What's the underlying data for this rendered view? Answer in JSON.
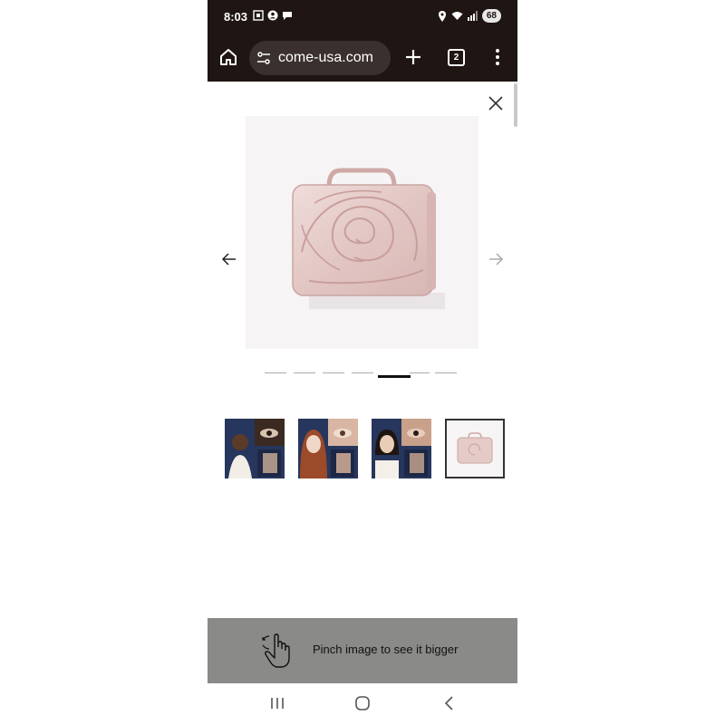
{
  "status_bar": {
    "time": "8:03",
    "battery": "68",
    "left_icons": [
      "screenshot-icon",
      "account-icon",
      "chat-icon"
    ],
    "right_icons": [
      "location-icon",
      "wifi-icon",
      "signal-icon"
    ]
  },
  "browser": {
    "url": "come-usa.com",
    "tab_count": "2",
    "toolbar_icons": [
      "home-icon",
      "site-settings-icon",
      "plus-icon",
      "tabs-icon",
      "more-vert-icon"
    ]
  },
  "viewer": {
    "image_count": 7,
    "active_index": 4,
    "main_image": "rose-embossed-vanity-case",
    "thumbnails": [
      {
        "name": "thumb-model-dark-skin",
        "selected": false
      },
      {
        "name": "thumb-model-red-hair",
        "selected": false
      },
      {
        "name": "thumb-model-asian",
        "selected": false
      },
      {
        "name": "thumb-rose-case",
        "selected": true
      }
    ]
  },
  "hint": {
    "text": "Pinch image to see it bigger",
    "icon": "pinch-hand-icon"
  },
  "nav_bar": {
    "icons": [
      "recent-apps-icon",
      "home-circle-icon",
      "back-icon"
    ]
  },
  "colors": {
    "browser_chrome": "#1f1512",
    "url_pill": "#3a302d",
    "hint_bg": "#8a8a89",
    "case_pink": "#e7cfcf"
  }
}
